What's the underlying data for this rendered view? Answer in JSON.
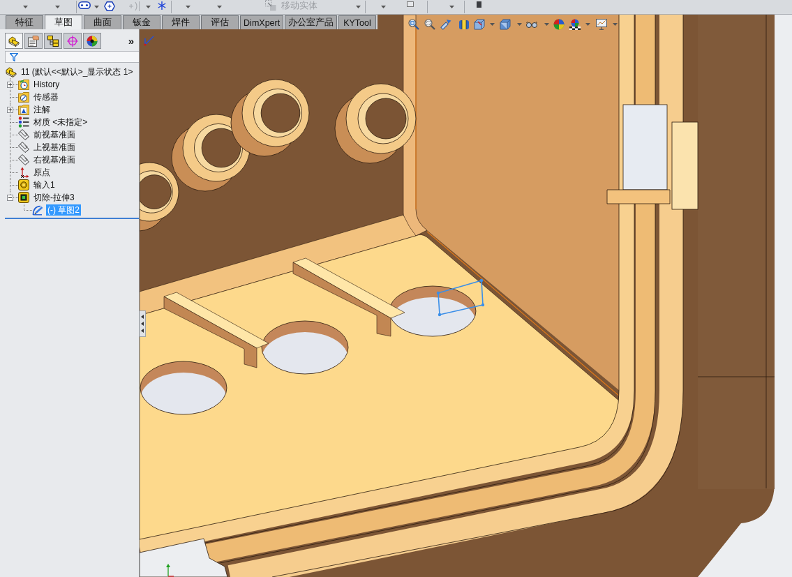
{
  "toolbar": {
    "move_entities": {
      "label": "移动实体",
      "disabled": true
    }
  },
  "command_tabs": [
    {
      "label": "特征",
      "selected": false
    },
    {
      "label": "草图",
      "selected": true
    },
    {
      "label": "曲面",
      "selected": false
    },
    {
      "label": "钣金",
      "selected": false
    },
    {
      "label": "焊件",
      "selected": false
    },
    {
      "label": "评估",
      "selected": false
    },
    {
      "label": "DimXpert",
      "selected": false
    },
    {
      "label": "办公室产品",
      "selected": false
    },
    {
      "label": "KYTool",
      "selected": false
    }
  ],
  "feature_manager": {
    "panel_tabs": [
      {
        "kind": "feature-tree",
        "selected": true
      },
      {
        "kind": "property",
        "selected": false
      },
      {
        "kind": "configuration",
        "selected": false
      },
      {
        "kind": "dimxpert",
        "selected": false
      },
      {
        "kind": "display",
        "selected": false
      }
    ],
    "overflow_symbol": "»",
    "tree": {
      "label": "11 (默认<<默认>_显示状态 1>",
      "kind": "part",
      "selected": false,
      "children": [
        {
          "label": "History",
          "kind": "history",
          "expanded": false,
          "selected": false
        },
        {
          "label": "传感器",
          "kind": "sensors",
          "selected": false
        },
        {
          "label": "注解",
          "kind": "annotations",
          "expanded": false,
          "selected": false
        },
        {
          "label": "材质 <未指定>",
          "kind": "material",
          "selected": false
        },
        {
          "label": "前视基准面",
          "kind": "plane",
          "selected": false
        },
        {
          "label": "上视基准面",
          "kind": "plane",
          "selected": false
        },
        {
          "label": "右视基准面",
          "kind": "plane",
          "selected": false
        },
        {
          "label": "原点",
          "kind": "origin",
          "selected": false
        },
        {
          "label": "输入1",
          "kind": "import",
          "selected": false
        },
        {
          "label": "切除-拉伸3",
          "kind": "cut-extrude",
          "expanded": true,
          "selected": false,
          "children": [
            {
              "label": "(-) 草图2",
              "kind": "sketch",
              "selected": true
            }
          ]
        }
      ]
    }
  }
}
